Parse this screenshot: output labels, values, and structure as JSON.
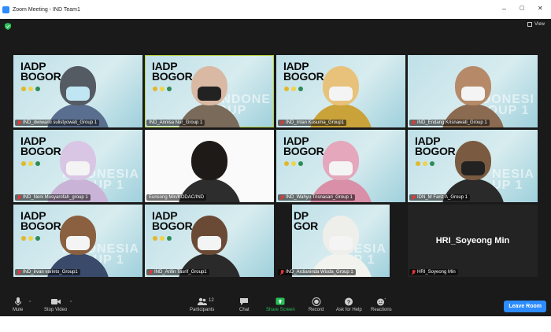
{
  "window": {
    "title": "Zoom Meeting - IND Team1",
    "minimize": "–",
    "maximize": "▢",
    "close": "✕"
  },
  "header": {
    "view_label": "View"
  },
  "logo": {
    "line1": "IADP",
    "line2": "BOGOR",
    "partial1": "DP",
    "partial2": "GOR"
  },
  "watermark": "INDONESIA\nGROUP 1",
  "colors": {
    "accent": "#2d8cff",
    "highlight": "#b5d33d",
    "share": "#27c057",
    "muted": "#e33333"
  },
  "tiles": [
    {
      "name": "IND_dwiwanti sulistyowati_Group 1",
      "muted": true
    },
    {
      "name": "IND_Annisa Nur_Group 1",
      "muted": false
    },
    {
      "name": "IND_Intan Kusuma_Group1",
      "muted": true
    },
    {
      "name": "IND_Endang Krisnawati_Group 1",
      "muted": true
    },
    {
      "name": "IND_Neni Musyarofah_group 1",
      "muted": true
    },
    {
      "name": "Eunsong Min/KODAC/IND",
      "muted": false
    },
    {
      "name": "IND_Wahyu Trisnasari_Group 1",
      "muted": true
    },
    {
      "name": "IDN_M Fariz A_Group 1",
      "muted": true
    },
    {
      "name": "IND_irvan varinto_Group1",
      "muted": true
    },
    {
      "name": "IND_Arifin Tasrif_Group1",
      "muted": true
    },
    {
      "name": "IND_Ardianinda Wisda_Group 1",
      "muted": true
    },
    {
      "name": "HRI_Soyeong Min",
      "muted": true
    }
  ],
  "camera_off_name": "HRI_Soyeong Min",
  "toolbar": {
    "mute": "Mute",
    "stop_video": "Stop Video",
    "participants": "Participants",
    "participants_count": "12",
    "chat": "Chat",
    "share_screen": "Share Screen",
    "record": "Record",
    "ask_for_help": "Ask for Help",
    "reactions": "Reactions",
    "leave": "Leave Room"
  }
}
